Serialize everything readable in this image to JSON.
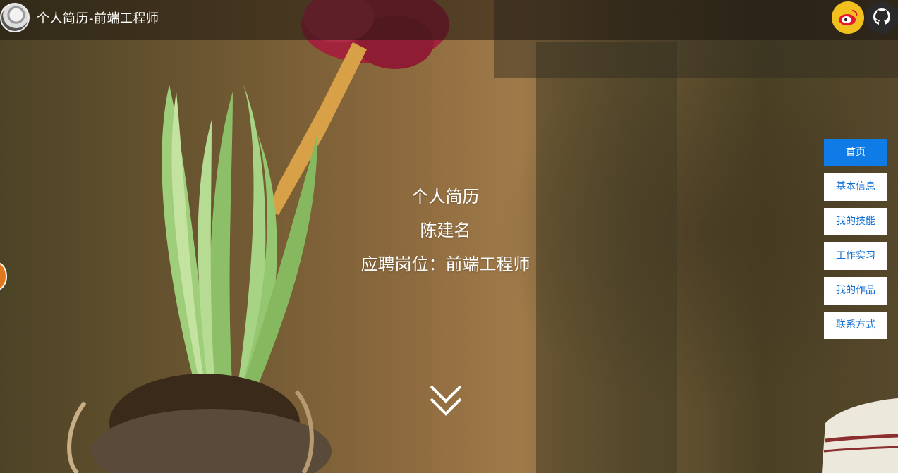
{
  "header": {
    "title": "个人简历-前端工程师"
  },
  "social": [
    {
      "name": "weibo-icon",
      "color": "#f2c01e"
    },
    {
      "name": "github-icon",
      "color": "#2a2a2a"
    }
  ],
  "hero": {
    "line1": "个人简历",
    "line2": "陈建名",
    "line3": "应聘岗位：前端工程师"
  },
  "nav": {
    "items": [
      {
        "label": "首页",
        "active": true
      },
      {
        "label": "基本信息",
        "active": false
      },
      {
        "label": "我的技能",
        "active": false
      },
      {
        "label": "工作实习",
        "active": false
      },
      {
        "label": "我的作品",
        "active": false
      },
      {
        "label": "联系方式",
        "active": false
      }
    ]
  },
  "colors": {
    "accent": "#0f7be6",
    "nav_text": "#0f6fd6"
  }
}
